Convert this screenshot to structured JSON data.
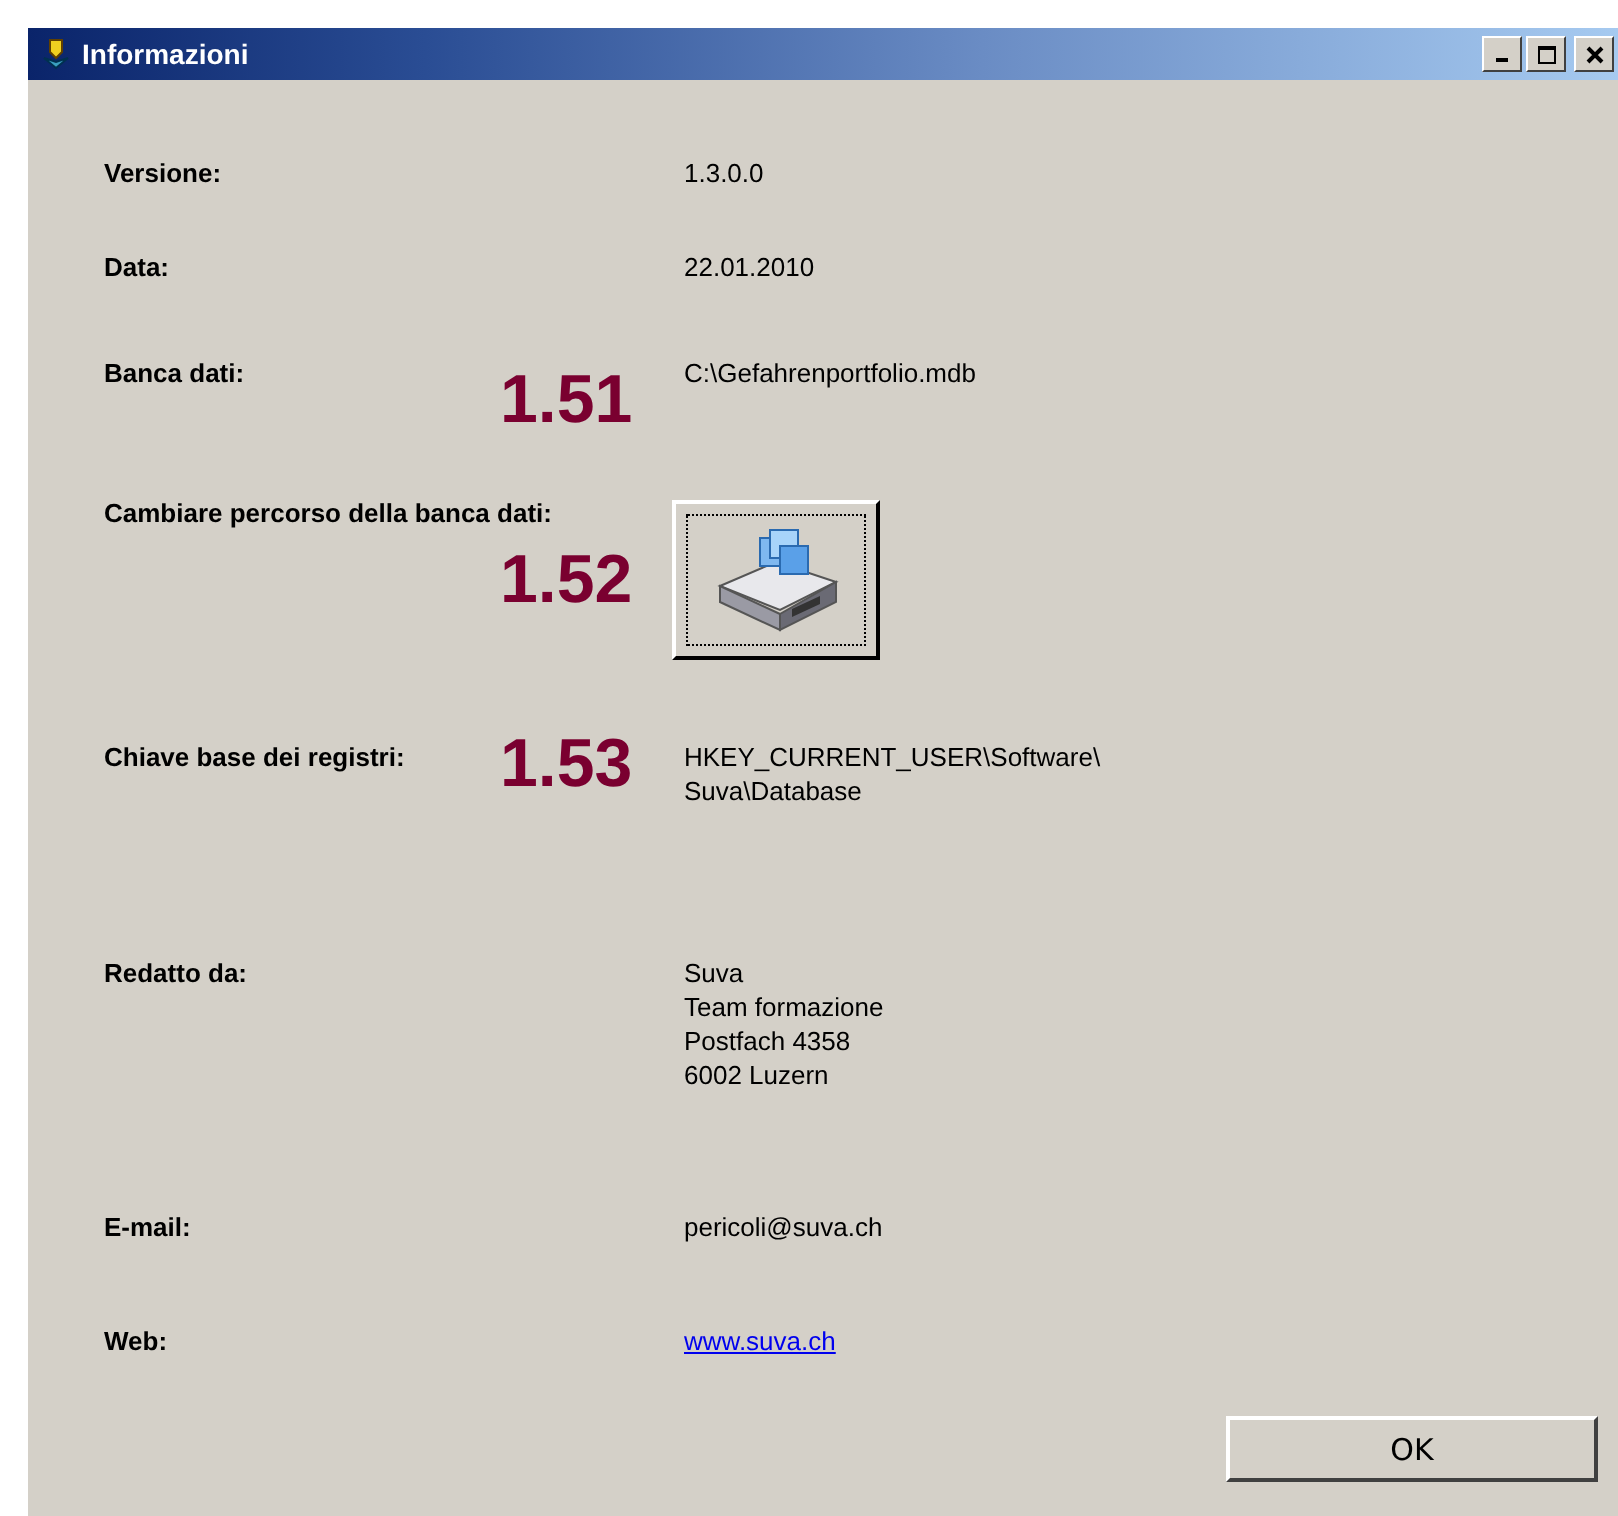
{
  "window": {
    "title": "Informazioni"
  },
  "rows": [
    {
      "kind": "text",
      "label": "Versione:",
      "lines": [
        "1.3.0.0"
      ]
    },
    {
      "kind": "text",
      "label": "Data:",
      "lines": [
        "22.01.2010"
      ]
    },
    {
      "kind": "text",
      "label": "Banca dati:",
      "lines": [
        "C:\\Gefahrenportfolio.mdb"
      ],
      "callout": "1.51"
    },
    {
      "kind": "button",
      "label": "Cambiare percorso della banca dati:",
      "callout": "1.52"
    },
    {
      "kind": "text",
      "label": "Chiave base dei registri:",
      "lines": [
        "HKEY_CURRENT_USER\\Software\\",
        "Suva\\Database"
      ],
      "callout": "1.53"
    },
    {
      "kind": "text",
      "label": "Redatto da:",
      "lines": [
        "Suva",
        "Team formazione",
        "Postfach 4358",
        "6002 Luzern"
      ]
    },
    {
      "kind": "text",
      "label": "E-mail:",
      "lines": [
        "pericoli@suva.ch"
      ]
    },
    {
      "kind": "link",
      "label": "Web:",
      "lines": [
        "www.suva.ch"
      ]
    }
  ],
  "ok_button": "OK"
}
